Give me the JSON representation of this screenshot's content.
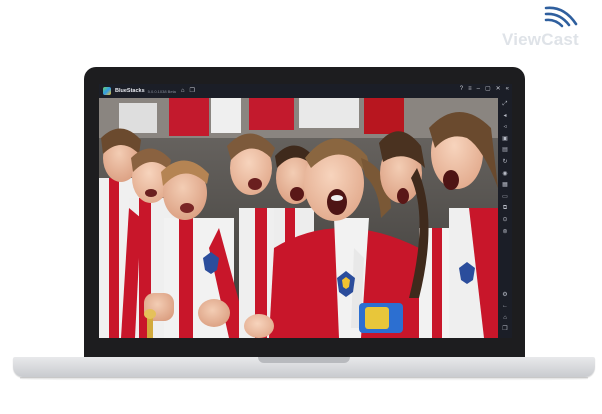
{
  "watermark": {
    "text": "ViewCast"
  },
  "app": {
    "title": "BlueStacks",
    "version": "5.0.0.1038 Beta"
  },
  "titlebar": {
    "icons": [
      "home-icon",
      "multi-instance-icon",
      "help-icon",
      "menu-icon",
      "minimize-icon",
      "restore-icon",
      "close-icon",
      "collapse-sidebar-icon"
    ]
  },
  "sidebar": {
    "icons": [
      "fullscreen-icon",
      "volume-up-icon",
      "volume-down-icon",
      "keymapping-icon",
      "install-apk-icon",
      "rotate-icon",
      "screenshot-icon",
      "record-icon",
      "media-folder-icon",
      "macro-icon",
      "multi-instance-sync-icon",
      "eco-mode-icon",
      "location-icon",
      "settings-icon",
      "back-icon",
      "home-icon",
      "recent-apps-icon"
    ]
  },
  "content": {
    "description_icon": "photo-image",
    "colors": {
      "jersey_red": "#c8162a",
      "jersey_white": "#f2f2f2",
      "captain_band": "#2c6fd1"
    }
  },
  "colors": {
    "lid": "#1d1d1f",
    "base": "#d7d8db",
    "bluestacks_bar": "#1b1e27",
    "watermark": "#dfe3e8"
  }
}
